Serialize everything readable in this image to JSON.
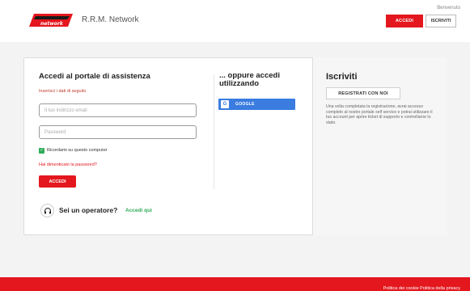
{
  "header": {
    "brand": "R.R.M. Network",
    "logo_text": "rrm network",
    "welcome": "Benvenuto",
    "login_button": "ACCEDI",
    "signup_button": "ISCRIVITI"
  },
  "login": {
    "title": "Accedi al portale di assistenza",
    "subtitle": "Inserisci i dati di seguito",
    "email_placeholder": "Il tuo indirizzo email",
    "password_placeholder": "Password",
    "remember_label": "Ricordami su questo computer",
    "forgot_link": "Hai dimenticato la password?",
    "submit_button": "ACCEDI"
  },
  "social": {
    "title": "... oppure accedi utilizzando",
    "google_label": "GOOGLE",
    "google_glyph": "G"
  },
  "operator": {
    "question": "Sei un operatore?",
    "link": "Accedi qui"
  },
  "signup": {
    "title": "Iscriviti",
    "button": "REGISTRATI CON NOI",
    "description": "Una volta completata la registrazione, avrai accesso completo al nostro portale self service e potrai utilizzare il tuo account per aprire ticket di supporto e controllarne lo stato."
  },
  "footer": {
    "links": "Politica dei cookie   Politica della privacy"
  },
  "colors": {
    "accent": "#e3171d",
    "google": "#3a7ce0",
    "success": "#2eab5a"
  }
}
